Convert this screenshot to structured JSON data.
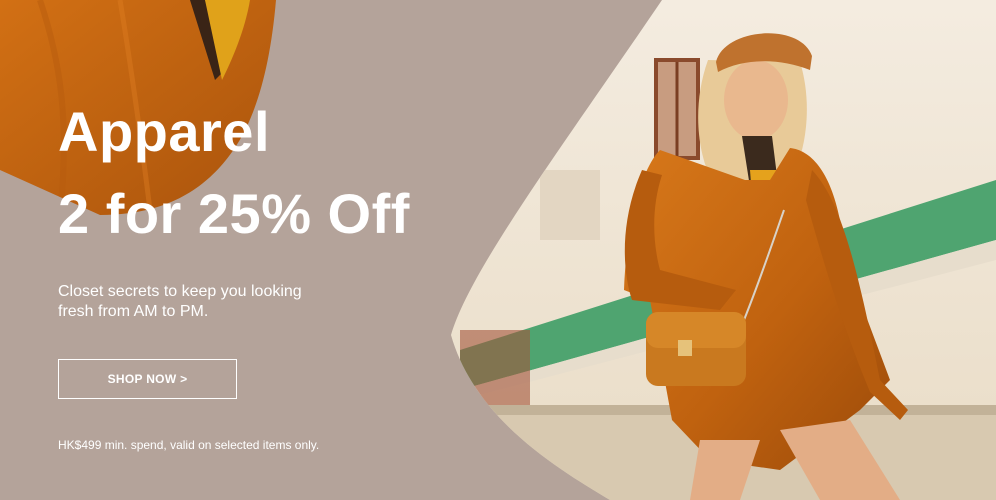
{
  "banner": {
    "headline_line1": "Apparel",
    "headline_line2": "2 for 25% Off",
    "subtext_line1": "Closet secrets to keep you looking",
    "subtext_line2": "fresh from AM to PM.",
    "cta_label": "SHOP NOW >",
    "disclaimer": "HK$499 min. spend, valid on selected items only."
  },
  "colors": {
    "panel": "#b4a39a",
    "text": "#ffffff",
    "corduroy_orange": "#c9670f",
    "wall_green": "#4fa470",
    "wall_cream": "#efe5d3"
  }
}
